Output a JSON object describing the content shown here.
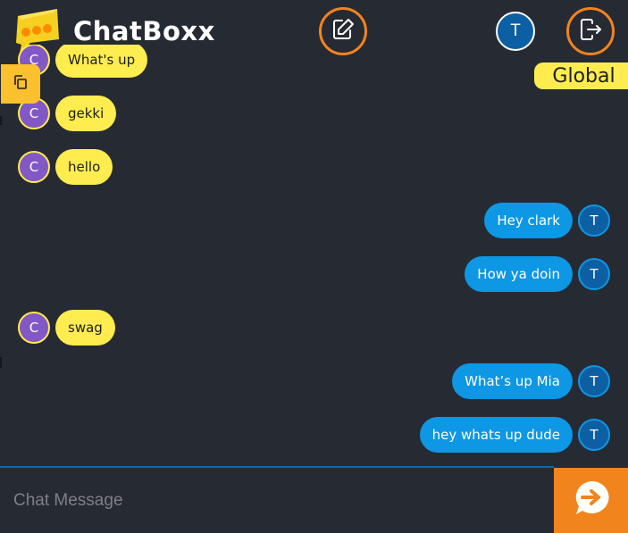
{
  "app": {
    "brand": "ChatBoxx"
  },
  "header": {
    "user_initial": "T",
    "room": "Global"
  },
  "messages": [
    {
      "dir": "in",
      "initial": "C",
      "text": "What's up"
    },
    {
      "dir": "in",
      "initial": "C",
      "text": "gekki"
    },
    {
      "dir": "in",
      "initial": "C",
      "text": "hello"
    },
    {
      "dir": "out",
      "initial": "T",
      "text": "Hey clark"
    },
    {
      "dir": "out",
      "initial": "T",
      "text": "How ya doin"
    },
    {
      "dir": "in",
      "initial": "C",
      "text": "swag"
    },
    {
      "dir": "out",
      "initial": "T",
      "text": "What’s up Mia"
    },
    {
      "dir": "out",
      "initial": "T",
      "text": "hey whats up dude"
    }
  ],
  "composer": {
    "placeholder": "Chat Message",
    "value": ""
  },
  "colors": {
    "background": "#262a33",
    "accent_orange": "#f2841d",
    "incoming_bubble": "#ffec4e",
    "outgoing_bubble": "#0d97e4",
    "incoming_avatar": "#8257c6",
    "outgoing_avatar": "#0d5fa3"
  },
  "icons": {
    "logo": "chat-bubbles-logo",
    "compose": "edit-icon",
    "logout": "logout-icon",
    "copy": "copy-icon",
    "send": "send-arrow-icon"
  }
}
